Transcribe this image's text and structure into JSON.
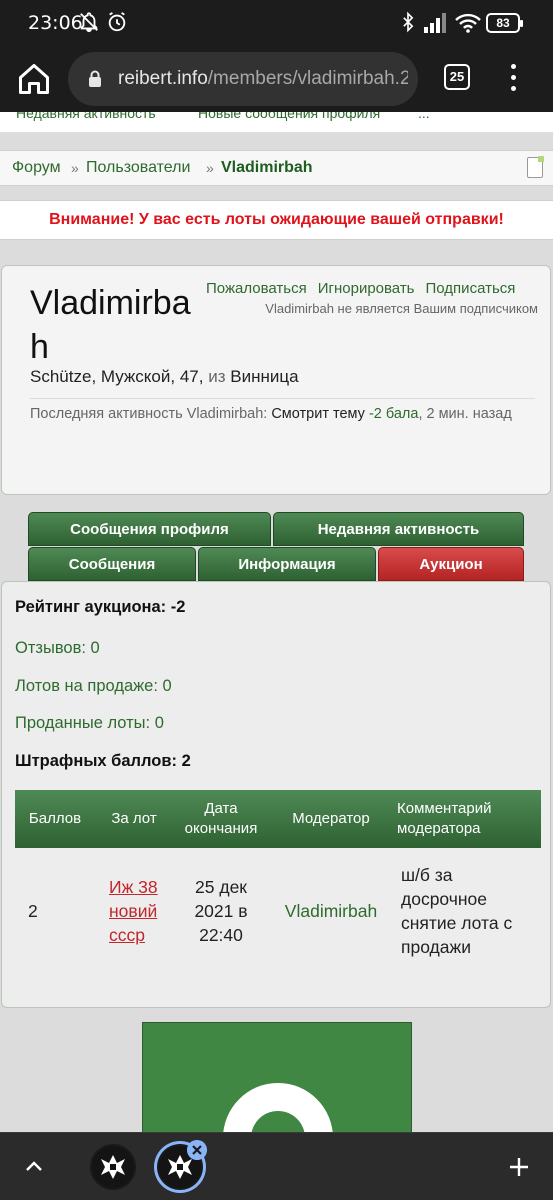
{
  "status_bar": {
    "time": "23:06",
    "battery": "83"
  },
  "browser": {
    "url_host": "reibert.info",
    "url_path": "/members/vladimirbah.2",
    "tab_count": "25"
  },
  "subnav": {
    "items": [
      "Недавняя активность",
      "Новые сообщения профиля",
      "..."
    ]
  },
  "breadcrumb": {
    "items": [
      "Форум",
      "Пользователи",
      "Vladimirbah"
    ],
    "separator": "»"
  },
  "alert": {
    "text": "Внимание! У вас есть лоты ожидающие вашей отправки!"
  },
  "profile": {
    "username": "Vladimirbah",
    "actions": [
      "Пожаловаться",
      "Игнорировать",
      "Подписаться"
    ],
    "subscription_status": "Vladimirbah не является Вашим подписчиком",
    "rank": "Schütze",
    "gender": "Мужской",
    "age": "47",
    "from_label": "из",
    "location": "Винница",
    "activity_prefix": "Последняя активность Vladimirbah:",
    "activity_action": "Смотрит тему",
    "activity_link": "-2 бала",
    "activity_time": "2 мин. назад"
  },
  "tabs": {
    "row1": [
      "Сообщения профиля",
      "Недавняя активность"
    ],
    "row2": [
      "Сообщения",
      "Информация",
      "Аукцион"
    ],
    "active": "Аукцион"
  },
  "auction": {
    "rating_label": "Рейтинг аукциона: -2",
    "reviews": "Отзывов: 0",
    "lots_for_sale": "Лотов на продаже: 0",
    "sold_lots": "Проданные лоты: 0",
    "penalty_label": "Штрафных баллов: 2",
    "table": {
      "headers": [
        "Баллов",
        "За лот",
        "Дата окончания",
        "Модератор",
        "Комментарий модератора"
      ],
      "rows": [
        {
          "points": "2",
          "lot": "Иж 38 новий ссср",
          "date": "25 дек 2021 в 22:40",
          "moderator": "Vladimirbah",
          "comment": "ш/б за досрочное снятие лота с продажи"
        }
      ]
    }
  },
  "colors": {
    "green": "#2e6b2e",
    "tab_green": "#3e7a44",
    "tab_active": "#c62e2e",
    "alert_red": "#e0131b"
  },
  "icons": [
    "home-icon",
    "lock-icon",
    "tabs-icon",
    "more-vert-icon",
    "chevron-up-icon",
    "iron-cross-icon",
    "close-icon",
    "plus-icon"
  ]
}
